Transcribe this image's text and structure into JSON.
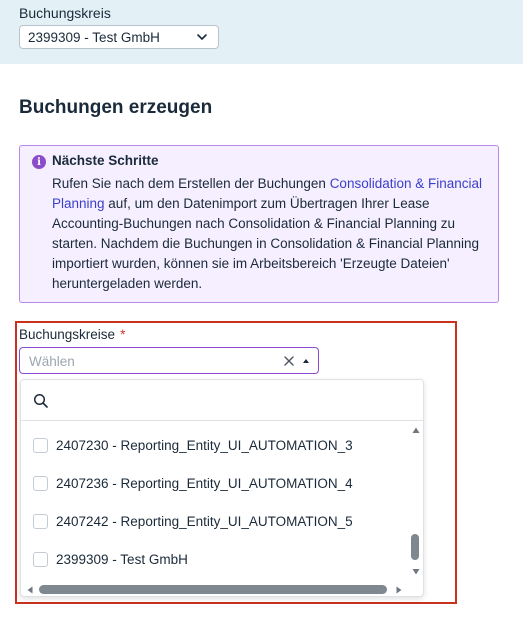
{
  "header": {
    "label": "Buchungskreis",
    "selected": "2399309 - Test GmbH",
    "chevron_icon": "chevron-down-icon"
  },
  "page": {
    "title": "Buchungen erzeugen"
  },
  "info": {
    "icon": "info-icon",
    "title": "Nächste Schritte",
    "text_before": "Rufen Sie nach dem Erstellen der Buchungen ",
    "link": "Consolidation & Financial Planning",
    "text_after": " auf, um den Datenimport zum Übertragen Ihrer Lease Accounting-Buchungen nach Consolidation & Financial Planning zu starten. Nachdem die Buchungen in Consolidation & Financial Planning importiert wurden, können sie im Arbeitsbereich 'Erzeugte Dateien' heruntergeladen werden.",
    "accent_color": "#8a4cc9"
  },
  "field": {
    "label": "Buchungskreise",
    "required_marker": "*",
    "placeholder": "Wählen"
  },
  "dropdown": {
    "search_icon": "search-icon",
    "options": [
      {
        "label": "2407230 - Reporting_Entity_UI_AUTOMATION_3",
        "checked": false
      },
      {
        "label": "2407236 - Reporting_Entity_UI_AUTOMATION_4",
        "checked": false
      },
      {
        "label": "2407242 - Reporting_Entity_UI_AUTOMATION_5",
        "checked": false
      },
      {
        "label": "2399309 - Test GmbH",
        "checked": false
      }
    ]
  },
  "colors": {
    "top_band": "#e3f1f7",
    "focus_border": "#8c4bd0",
    "highlight_frame": "#c7331f"
  }
}
